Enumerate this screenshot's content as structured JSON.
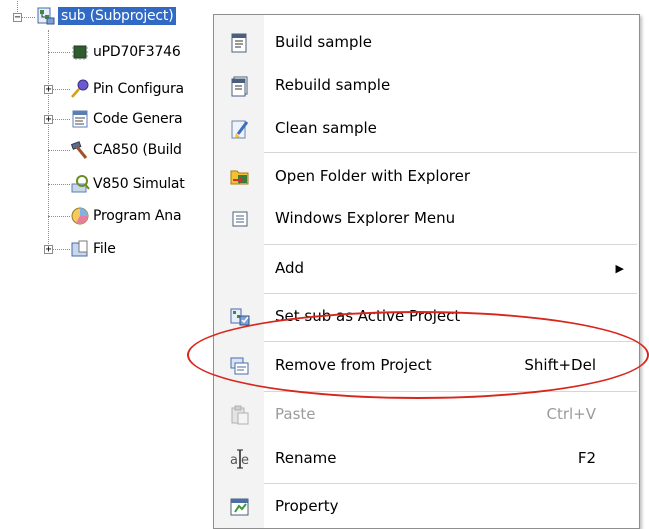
{
  "tree": {
    "root": {
      "label": "sub (Subproject)",
      "icon": "subproject-icon",
      "expanded": true
    },
    "children": [
      {
        "label": "uPD70F3746",
        "icon": "microcontroller-chip-icon",
        "expander": ""
      },
      {
        "label": "Pin Configura",
        "icon": "pin-configurator-icon",
        "expander": "+"
      },
      {
        "label": "Code Genera",
        "icon": "code-generator-icon",
        "expander": "+"
      },
      {
        "label": "CA850 (Build",
        "icon": "build-tool-hammer-icon",
        "expander": ""
      },
      {
        "label": "V850 Simulat",
        "icon": "simulator-icon",
        "expander": ""
      },
      {
        "label": "Program Ana",
        "icon": "program-analyzer-icon",
        "expander": ""
      },
      {
        "label": "File",
        "icon": "file-folder-icon",
        "expander": "+"
      }
    ]
  },
  "context_menu": {
    "items": [
      {
        "label": "Build sample",
        "icon": "build-icon"
      },
      {
        "label": "Rebuild sample",
        "icon": "rebuild-icon"
      },
      {
        "label": "Clean sample",
        "icon": "clean-icon"
      },
      {
        "label": "Open Folder with Explorer",
        "icon": "open-folder-icon"
      },
      {
        "label": "Windows Explorer Menu",
        "icon": "explorer-menu-icon"
      },
      {
        "label": "Add",
        "icon": "",
        "submenu_arrow": "▶"
      },
      {
        "label": "Set sub as Active Project",
        "icon": "active-project-icon"
      },
      {
        "label": "Remove from Project",
        "icon": "remove-icon",
        "shortcut": "Shift+Del",
        "highlighted": true
      },
      {
        "label": "Paste",
        "icon": "paste-icon",
        "shortcut": "Ctrl+V",
        "disabled": true
      },
      {
        "label": "Rename",
        "icon": "rename-icon",
        "shortcut": "F2"
      },
      {
        "label": "Property",
        "icon": "property-icon"
      }
    ]
  },
  "colors": {
    "selection": "#316ac5",
    "highlight_ellipse": "#d9261c",
    "menu_gutter": "#f3f3f3",
    "disabled_text": "#9b9b9b"
  }
}
